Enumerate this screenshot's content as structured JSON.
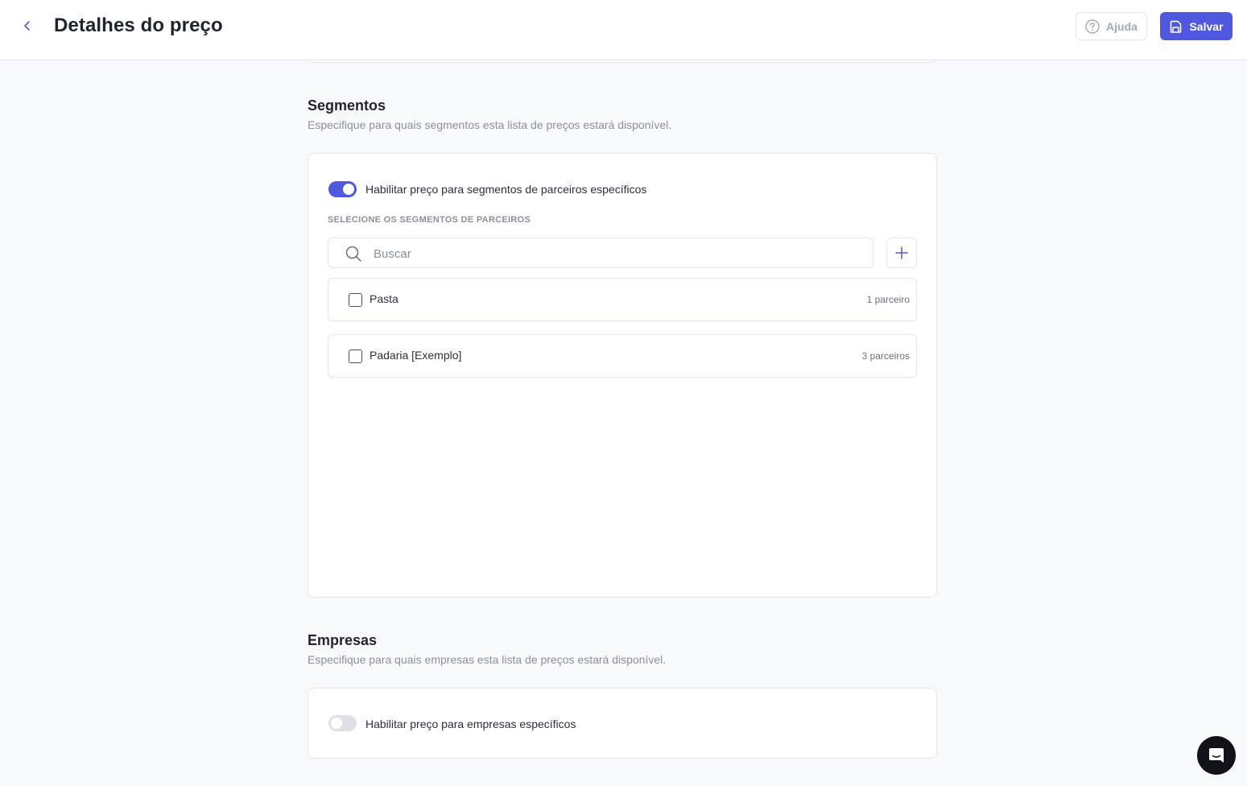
{
  "header": {
    "title": "Detalhes do preço",
    "help_label": "Ajuda",
    "save_label": "Salvar"
  },
  "segments": {
    "title": "Segmentos",
    "description": "Especifique para quais segmentos esta lista de preços estará disponível.",
    "toggle_label": "Habilitar preço para segmentos de parceiros específicos",
    "toggle_on": true,
    "select_heading": "SELECIONE OS SEGMENTOS DE PARCEIROS",
    "search_placeholder": "Buscar",
    "search_value": "",
    "items": [
      {
        "name": "Pasta",
        "count": "1 parceiro",
        "checked": false
      },
      {
        "name": "Padaria [Exemplo]",
        "count": "3 parceiros",
        "checked": false
      }
    ]
  },
  "companies": {
    "title": "Empresas",
    "description": "Especifique para quais empresas esta lista de preços estará disponível.",
    "toggle_label": "Habilitar preço para empresas específicos",
    "toggle_on": false
  },
  "colors": {
    "accent": "#5058e0",
    "background": "#f8f9fb",
    "border": "#e3e6ec"
  },
  "icons": {
    "back": "chevron-left-icon",
    "help": "question-circle-icon",
    "save": "save-icon",
    "search": "search-icon",
    "add": "plus-icon",
    "chat": "chat-icon"
  }
}
